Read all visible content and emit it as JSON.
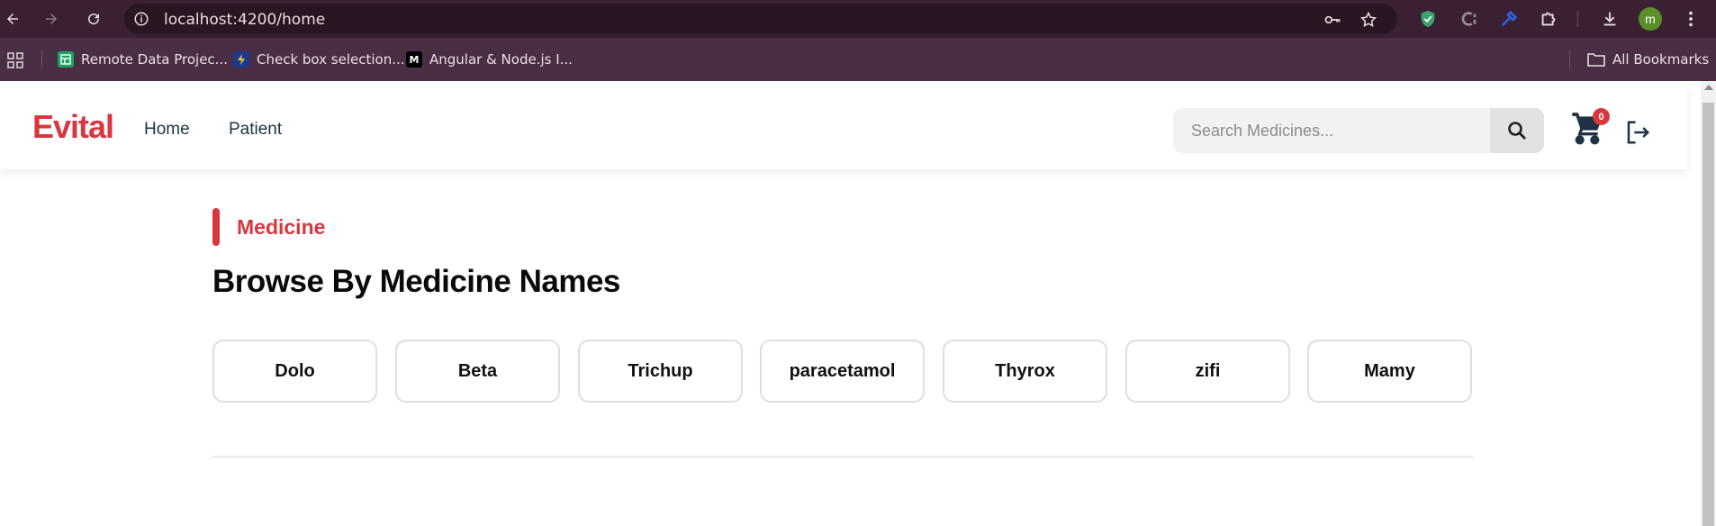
{
  "browser": {
    "url": "localhost:4200/home",
    "profile_initial": "m",
    "bookmarks": [
      {
        "label": "Remote Data Projec...",
        "icon": "sheets-icon"
      },
      {
        "label": "Check box selection...",
        "icon": "stackblitz-icon"
      },
      {
        "label": "Angular & Node.js I...",
        "icon": "medium-icon",
        "fav_text": "M"
      }
    ],
    "all_bookmarks": "All Bookmarks"
  },
  "header": {
    "logo": "Evital",
    "nav": [
      "Home",
      "Patient"
    ],
    "search_placeholder": "Search Medicines...",
    "cart_count": "0"
  },
  "main": {
    "section_label": "Medicine",
    "title": "Browse By Medicine Names",
    "medicines": [
      "Dolo",
      "Beta",
      "Trichup",
      "paracetamol",
      "Thyrox",
      "zifi",
      "Mamy"
    ]
  },
  "colors": {
    "brand": "#d9373f",
    "chrome_dark": "#3b1f33",
    "bookmarks_bar": "#4a2e43"
  }
}
